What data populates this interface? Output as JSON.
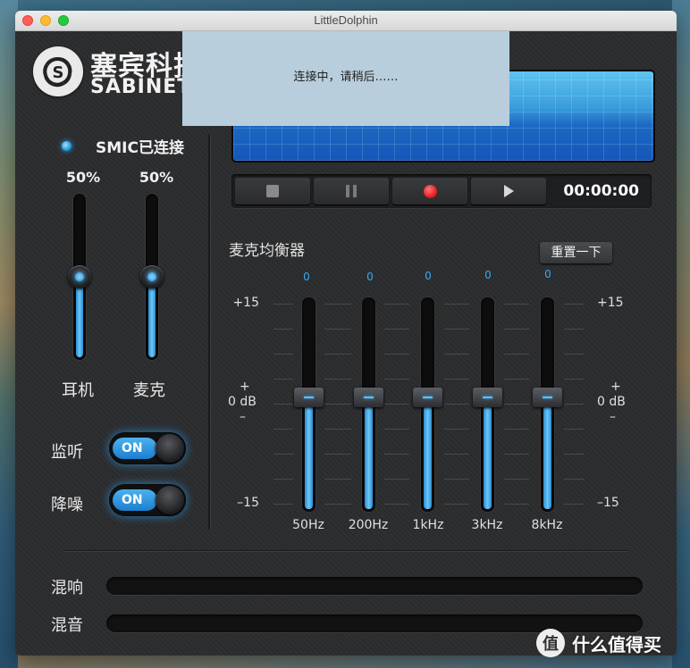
{
  "window": {
    "title": "LittleDolphin"
  },
  "brand": {
    "name_cn": "塞宾科技",
    "name_en": "SABINETEK"
  },
  "dialog": {
    "message": "连接中，请稍后……"
  },
  "status": {
    "text": "SMIC已连接"
  },
  "outputs": [
    {
      "label": "耳机",
      "percent_text": "50%",
      "level": 0.5
    },
    {
      "label": "麦克",
      "percent_text": "50%",
      "level": 0.5
    }
  ],
  "toggles": [
    {
      "label": "监听",
      "state": "ON"
    },
    {
      "label": "降噪",
      "state": "ON"
    }
  ],
  "transport": {
    "buttons": [
      "stop-icon",
      "pause-icon",
      "record-icon",
      "play-icon"
    ],
    "time": "00:00:00"
  },
  "equalizer": {
    "title": "麦克均衡器",
    "reset_label": "重置一下",
    "scale_top": "+15",
    "scale_plus": "+",
    "scale_mid": "0 dB",
    "scale_minus": "–",
    "scale_bottom": "–15",
    "bands": [
      {
        "freq": "50Hz",
        "value": "0"
      },
      {
        "freq": "200Hz",
        "value": "0"
      },
      {
        "freq": "1kHz",
        "value": "0"
      },
      {
        "freq": "3kHz",
        "value": "0"
      },
      {
        "freq": "8kHz",
        "value": "0"
      }
    ]
  },
  "mixers": [
    {
      "label": "混响"
    },
    {
      "label": "混音"
    }
  ],
  "watermark": {
    "text": "什么值得买",
    "symbol": "值"
  },
  "colors": {
    "accent": "#3aa8f0",
    "record": "#e81e28",
    "panel": "#2b2c2e"
  }
}
